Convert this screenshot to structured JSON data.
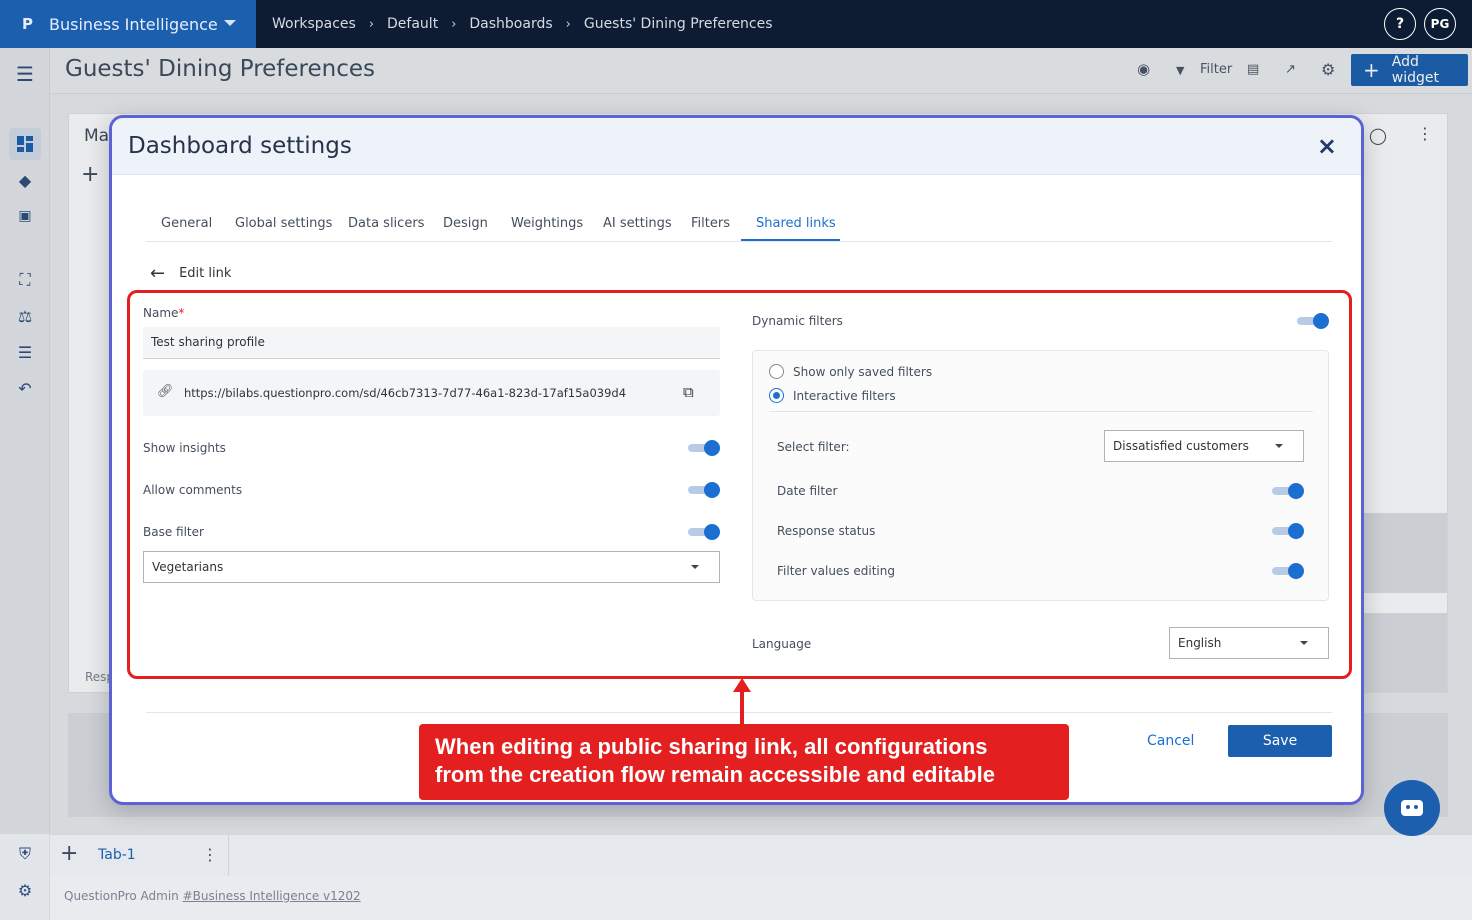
{
  "app": {
    "logo": "P",
    "name": "Business Intelligence",
    "user_initials": "PG",
    "help_label": "?"
  },
  "breadcrumbs": [
    "Workspaces",
    "Default",
    "Dashboards",
    "Guests' Dining Preferences"
  ],
  "page": {
    "title": "Guests' Dining Preferences",
    "filter_label": "Filter",
    "add_widget_label": "Add widget",
    "widget_title_fragment": "Ma",
    "widget_footer_fragment": "Resp"
  },
  "sidebar": {
    "icons": [
      "dashboard-icon",
      "diamond-icon",
      "report-icon",
      "scan-icon",
      "balance-icon",
      "list-icon",
      "undo-icon",
      "shield-icon",
      "gear-icon"
    ]
  },
  "tabbar": {
    "tab_label": "Tab-1"
  },
  "footer": {
    "prefix": "QuestionPro Admin",
    "link": "#Business Intelligence v1202"
  },
  "modal": {
    "title": "Dashboard settings",
    "close": "×",
    "tabs": [
      "General",
      "Global settings",
      "Data slicers",
      "Design",
      "Weightings",
      "AI settings",
      "Filters",
      "Shared links"
    ],
    "active_tab": "Shared links",
    "edit_link_label": "Edit link",
    "name_label": "Name",
    "name_required": "*",
    "name_value": "Test sharing profile",
    "url": "https://bilabs.questionpro.com/sd/46cb7313-7d77-46a1-823d-17af15a039d4",
    "show_insights_label": "Show insights",
    "allow_comments_label": "Allow comments",
    "base_filter_label": "Base filter",
    "base_filter_value": "Vegetarians",
    "dynamic_filters_label": "Dynamic filters",
    "radio_saved_label": "Show only saved filters",
    "radio_interactive_label": "Interactive filters",
    "select_filter_label": "Select filter:",
    "select_filter_value": "Dissatisfied customers",
    "date_filter_label": "Date filter",
    "response_status_label": "Response status",
    "filter_values_editing_label": "Filter values editing",
    "language_label": "Language",
    "language_value": "English",
    "cancel_label": "Cancel",
    "save_label": "Save"
  },
  "annotation": {
    "line1": "When editing a public sharing link, all configurations",
    "line2": "from the creation flow remain accessible and editable"
  },
  "colors": {
    "brand": "#1b5fae",
    "topbar": "#0d1b33",
    "highlight": "#e3201f",
    "accent": "#1b6fd0"
  }
}
